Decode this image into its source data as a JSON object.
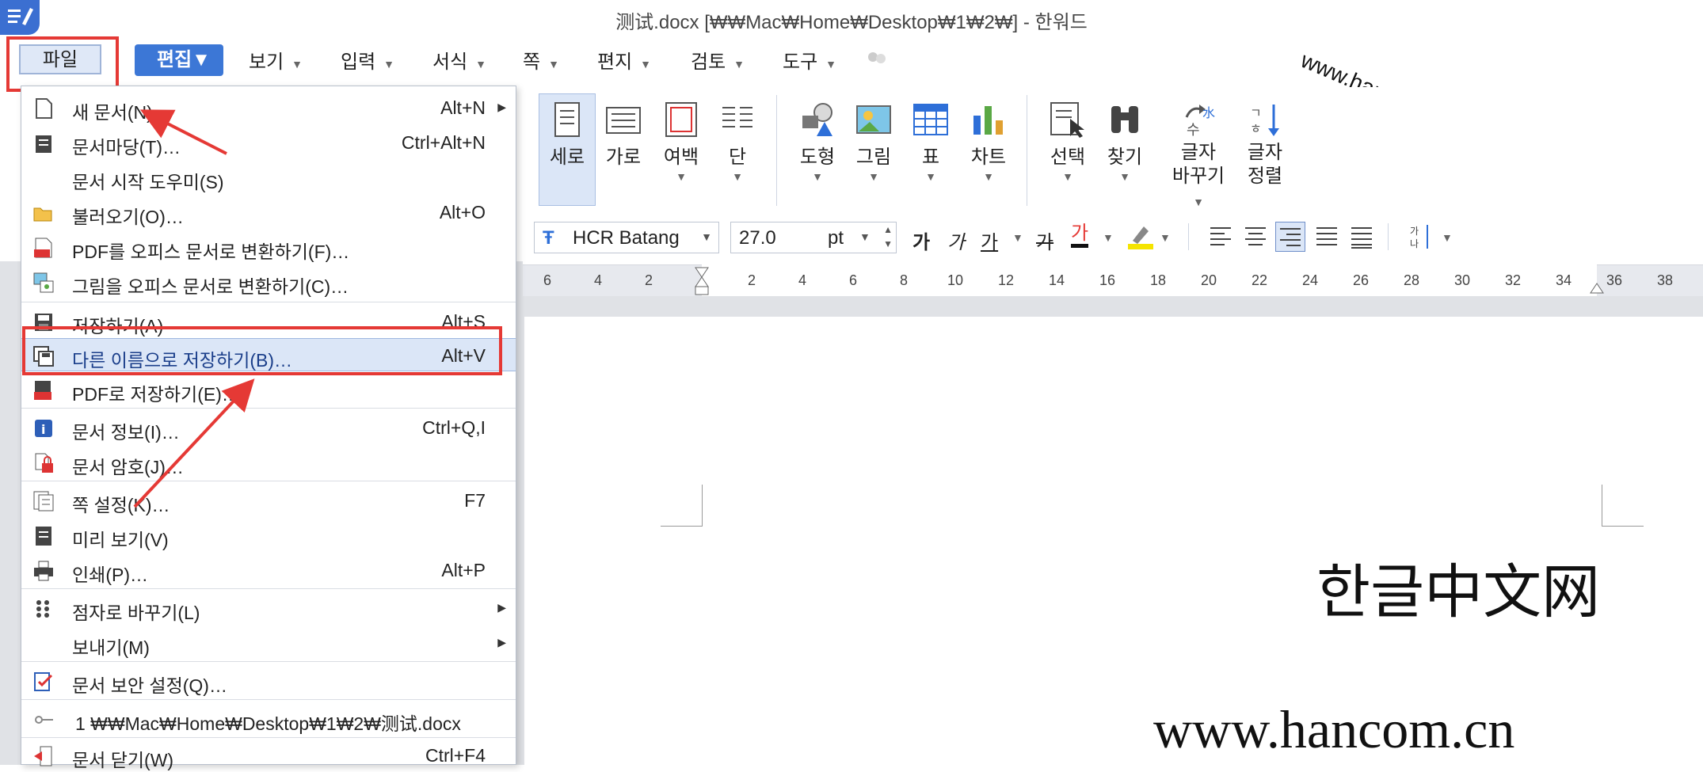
{
  "window": {
    "title": "测试.docx [₩₩Mac₩Home₩Desktop₩1₩2₩] - 한워드"
  },
  "menubar": {
    "file": "파일",
    "edit": "편집",
    "items": [
      "보기",
      "입력",
      "서식",
      "쪽",
      "편지",
      "검토",
      "도구"
    ]
  },
  "watermark": "www.hancom.cn",
  "ribbon": {
    "buttons": [
      {
        "label": "세로",
        "icon": "portrait-page-icon"
      },
      {
        "label": "가로",
        "icon": "landscape-page-icon"
      },
      {
        "label": "여백",
        "icon": "margin-icon"
      },
      {
        "label": "단",
        "icon": "columns-icon"
      },
      {
        "label": "도형",
        "icon": "shape-icon"
      },
      {
        "label": "그림",
        "icon": "picture-icon"
      },
      {
        "label": "표",
        "icon": "table-icon"
      },
      {
        "label": "차트",
        "icon": "chart-icon"
      },
      {
        "label": "선택",
        "icon": "select-icon"
      },
      {
        "label": "찾기",
        "icon": "binoculars-icon"
      },
      {
        "label1": "글자",
        "label2": "바꾸기",
        "icon": "char-replace-icon"
      },
      {
        "label1": "글자",
        "label2": "정렬",
        "icon": "char-sort-icon"
      }
    ]
  },
  "formatbar": {
    "font": "HCR Batang",
    "size": "27.0",
    "unit": "pt",
    "styles": [
      "가",
      "가",
      "가",
      "가",
      "가"
    ]
  },
  "ruler": {
    "ticks": [
      "6",
      "4",
      "2",
      "2",
      "4",
      "6",
      "8",
      "10",
      "12",
      "14",
      "16",
      "18",
      "20",
      "22",
      "24",
      "26",
      "28",
      "30",
      "32",
      "34",
      "36",
      "38"
    ]
  },
  "document": {
    "line1": "한글中文网",
    "line2": "www.hancom.cn"
  },
  "file_menu": {
    "items": [
      {
        "label": "새 문서(N)",
        "shortcut": "Alt+N",
        "submenu": true,
        "icon": "new-doc-icon"
      },
      {
        "label": "문서마당(T)…",
        "shortcut": "Ctrl+Alt+N",
        "icon": "template-icon"
      },
      {
        "label": "문서 시작 도우미(S)",
        "shortcut": "",
        "icon": ""
      },
      {
        "label": "불러오기(O)…",
        "shortcut": "Alt+O",
        "icon": "open-folder-icon"
      },
      {
        "label": "PDF를 오피스 문서로 변환하기(F)…",
        "shortcut": "",
        "icon": "pdf-convert-icon"
      },
      {
        "label": "그림을 오피스 문서로 변환하기(C)…",
        "shortcut": "",
        "icon": "image-convert-icon"
      },
      {
        "label": "저장하기(A)",
        "shortcut": "Alt+S",
        "icon": "save-icon"
      },
      {
        "label": "다른 이름으로 저장하기(B)…",
        "shortcut": "Alt+V",
        "icon": "save-as-icon"
      },
      {
        "label": "PDF로 저장하기(E)…",
        "shortcut": "",
        "icon": "save-pdf-icon"
      },
      {
        "label": "문서 정보(I)…",
        "shortcut": "Ctrl+Q,I",
        "icon": "info-icon"
      },
      {
        "label": "문서 암호(J)…",
        "shortcut": "",
        "icon": "lock-icon"
      },
      {
        "label": "쪽 설정(K)…",
        "shortcut": "F7",
        "icon": "page-setup-icon"
      },
      {
        "label": "미리 보기(V)",
        "shortcut": "",
        "icon": "preview-icon"
      },
      {
        "label": "인쇄(P)…",
        "shortcut": "Alt+P",
        "icon": "print-icon"
      },
      {
        "label": "점자로 바꾸기(L)",
        "shortcut": "",
        "submenu": true,
        "icon": "braille-icon"
      },
      {
        "label": "보내기(M)",
        "shortcut": "",
        "submenu": true,
        "icon": ""
      },
      {
        "label": "문서 보안 설정(Q)…",
        "shortcut": "",
        "icon": "security-icon"
      },
      {
        "label": "1 ₩₩Mac₩Home₩Desktop₩1₩2₩测试.docx",
        "shortcut": "",
        "icon": "recent-file-icon"
      },
      {
        "label": "문서 닫기(W)",
        "shortcut": "Ctrl+F4",
        "icon": "close-doc-icon"
      }
    ]
  },
  "colors": {
    "accent": "#3c77d6",
    "highlight": "#e53935"
  }
}
